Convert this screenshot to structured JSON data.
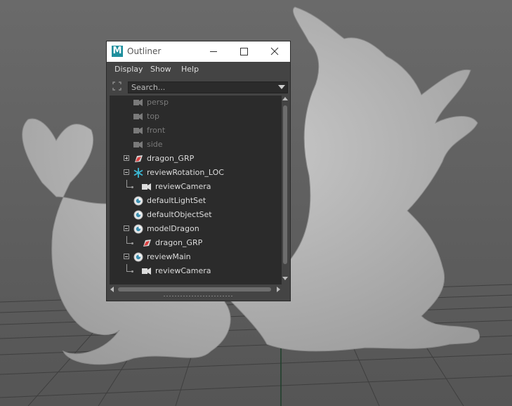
{
  "window": {
    "title": "Outliner",
    "app_logo_letter": "M",
    "accent_color": "#1f8f9d"
  },
  "menu": {
    "items": [
      "Display",
      "Show",
      "Help"
    ]
  },
  "search": {
    "placeholder": "Search..."
  },
  "tree": {
    "rows": [
      {
        "label": "persp",
        "icon": "camera-icon",
        "dim": true,
        "level": 0
      },
      {
        "label": "top",
        "icon": "camera-icon",
        "dim": true,
        "level": 0
      },
      {
        "label": "front",
        "icon": "camera-icon",
        "dim": true,
        "level": 0
      },
      {
        "label": "side",
        "icon": "camera-icon",
        "dim": true,
        "level": 0
      },
      {
        "label": "dragon_GRP",
        "icon": "transform-group-icon",
        "expander": "collapsed",
        "level": 0
      },
      {
        "label": "reviewRotation_LOC",
        "icon": "locator-icon",
        "expander": "expanded",
        "level": 0
      },
      {
        "label": "reviewCamera",
        "icon": "camera-icon",
        "level": 1
      },
      {
        "label": "defaultLightSet",
        "icon": "set-icon",
        "level": 0
      },
      {
        "label": "defaultObjectSet",
        "icon": "set-icon",
        "level": 0
      },
      {
        "label": "modelDragon",
        "icon": "set-icon",
        "expander": "expanded",
        "level": 0
      },
      {
        "label": "dragon_GRP",
        "icon": "transform-group-icon",
        "level": 1
      },
      {
        "label": "reviewMain",
        "icon": "set-icon",
        "expander": "expanded",
        "level": 0
      },
      {
        "label": "reviewCamera",
        "icon": "camera-icon",
        "level": 1
      }
    ]
  }
}
